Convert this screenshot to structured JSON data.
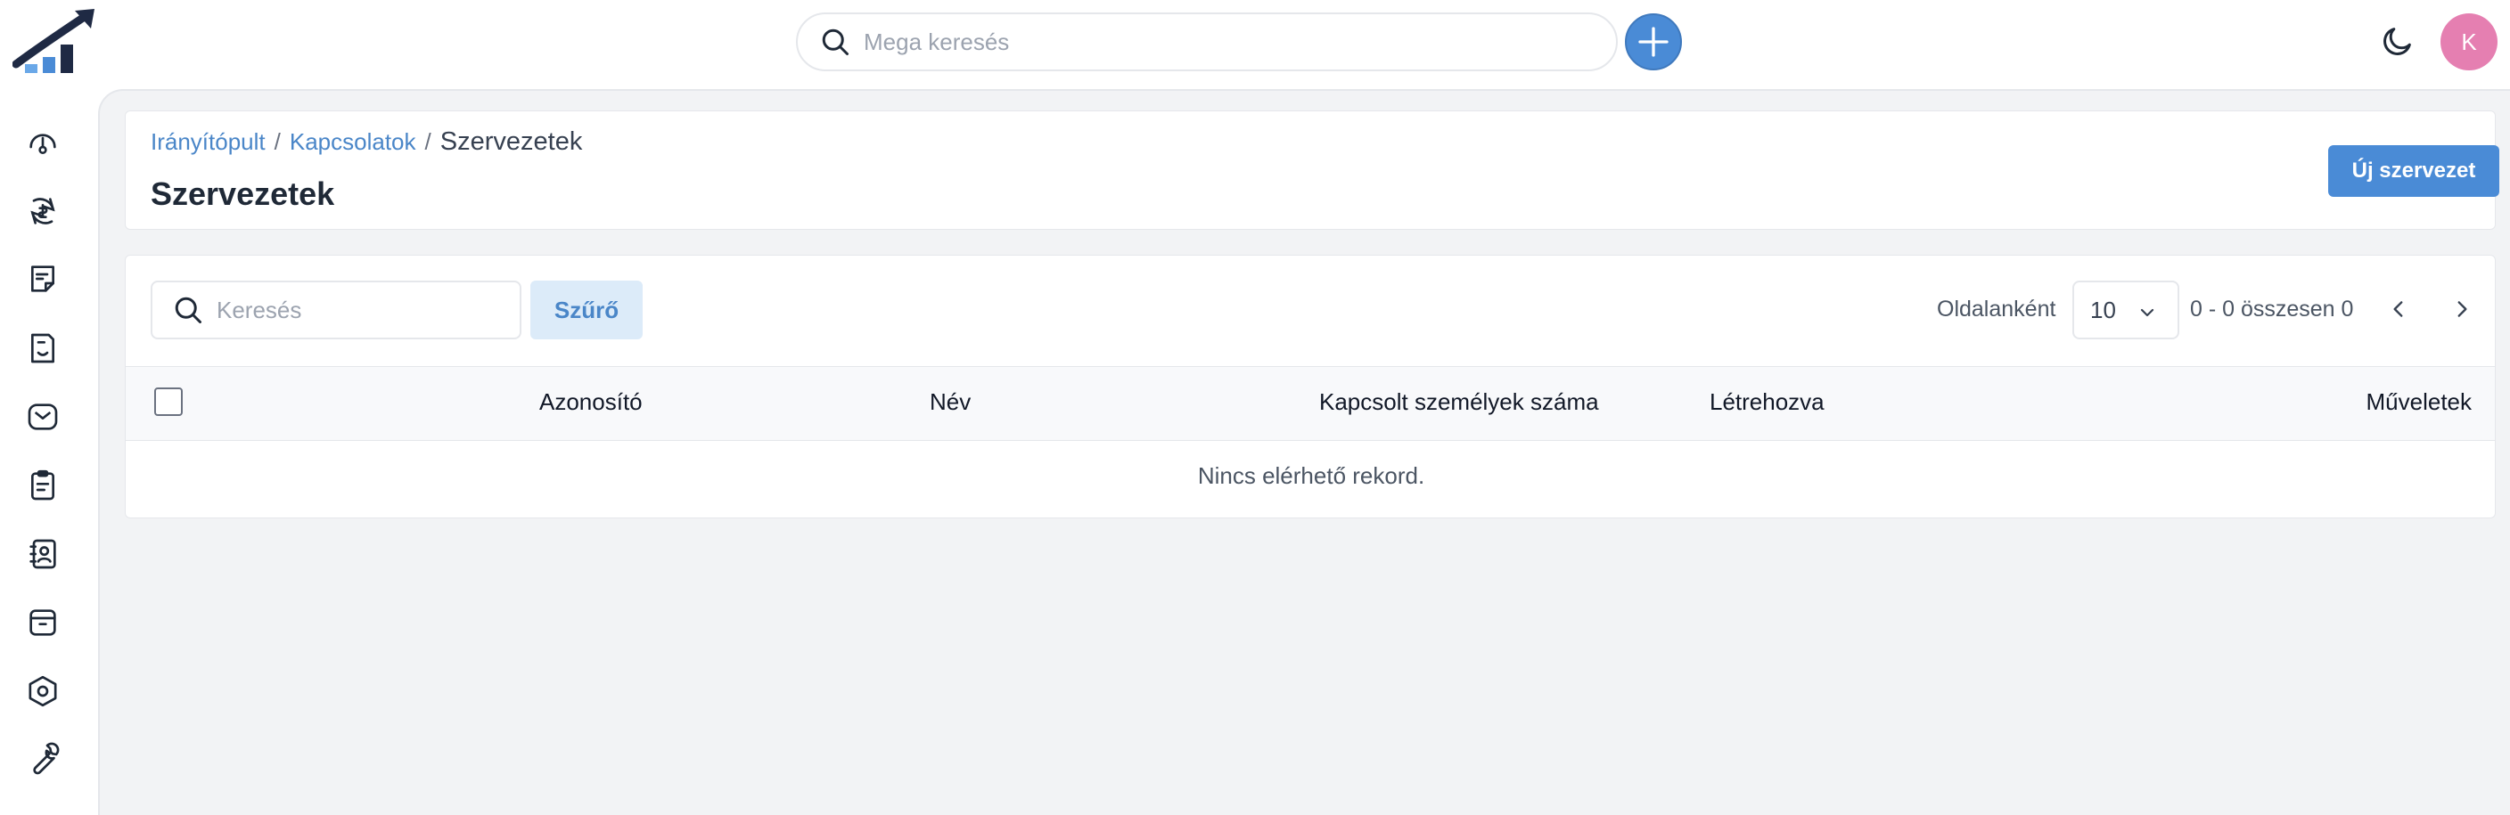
{
  "topbar": {
    "mega_search_placeholder": "Mega keresés",
    "avatar_initial": "K",
    "brand_color": "#4a8bd6",
    "avatar_color": "#e57fb1"
  },
  "sidebar": {
    "items": [
      {
        "icon": "dashboard-gauge-icon"
      },
      {
        "icon": "sales-cycle-icon"
      },
      {
        "icon": "notes-icon"
      },
      {
        "icon": "document-contract-icon"
      },
      {
        "icon": "mail-icon"
      },
      {
        "icon": "clipboard-list-icon"
      },
      {
        "icon": "contacts-book-icon"
      },
      {
        "icon": "archive-box-icon"
      },
      {
        "icon": "settings-hexagon-icon"
      },
      {
        "icon": "wrench-icon"
      }
    ]
  },
  "breadcrumb": {
    "items": [
      "Irányítópult",
      "Kapcsolatok"
    ],
    "separator": "/",
    "current": "Szervezetek"
  },
  "page": {
    "title": "Szervezetek",
    "new_button": "Új szervezet"
  },
  "table_toolbar": {
    "search_placeholder": "Keresés",
    "filter_label": "Szűrő",
    "per_page_label": "Oldalanként",
    "per_page_value": "10",
    "range_text": "0 - 0 összesen 0"
  },
  "table": {
    "columns": [
      "Azonosító",
      "Név",
      "Kapcsolt személyek száma",
      "Létrehozva",
      "Műveletek"
    ],
    "empty_message": "Nincs elérhető rekord."
  }
}
